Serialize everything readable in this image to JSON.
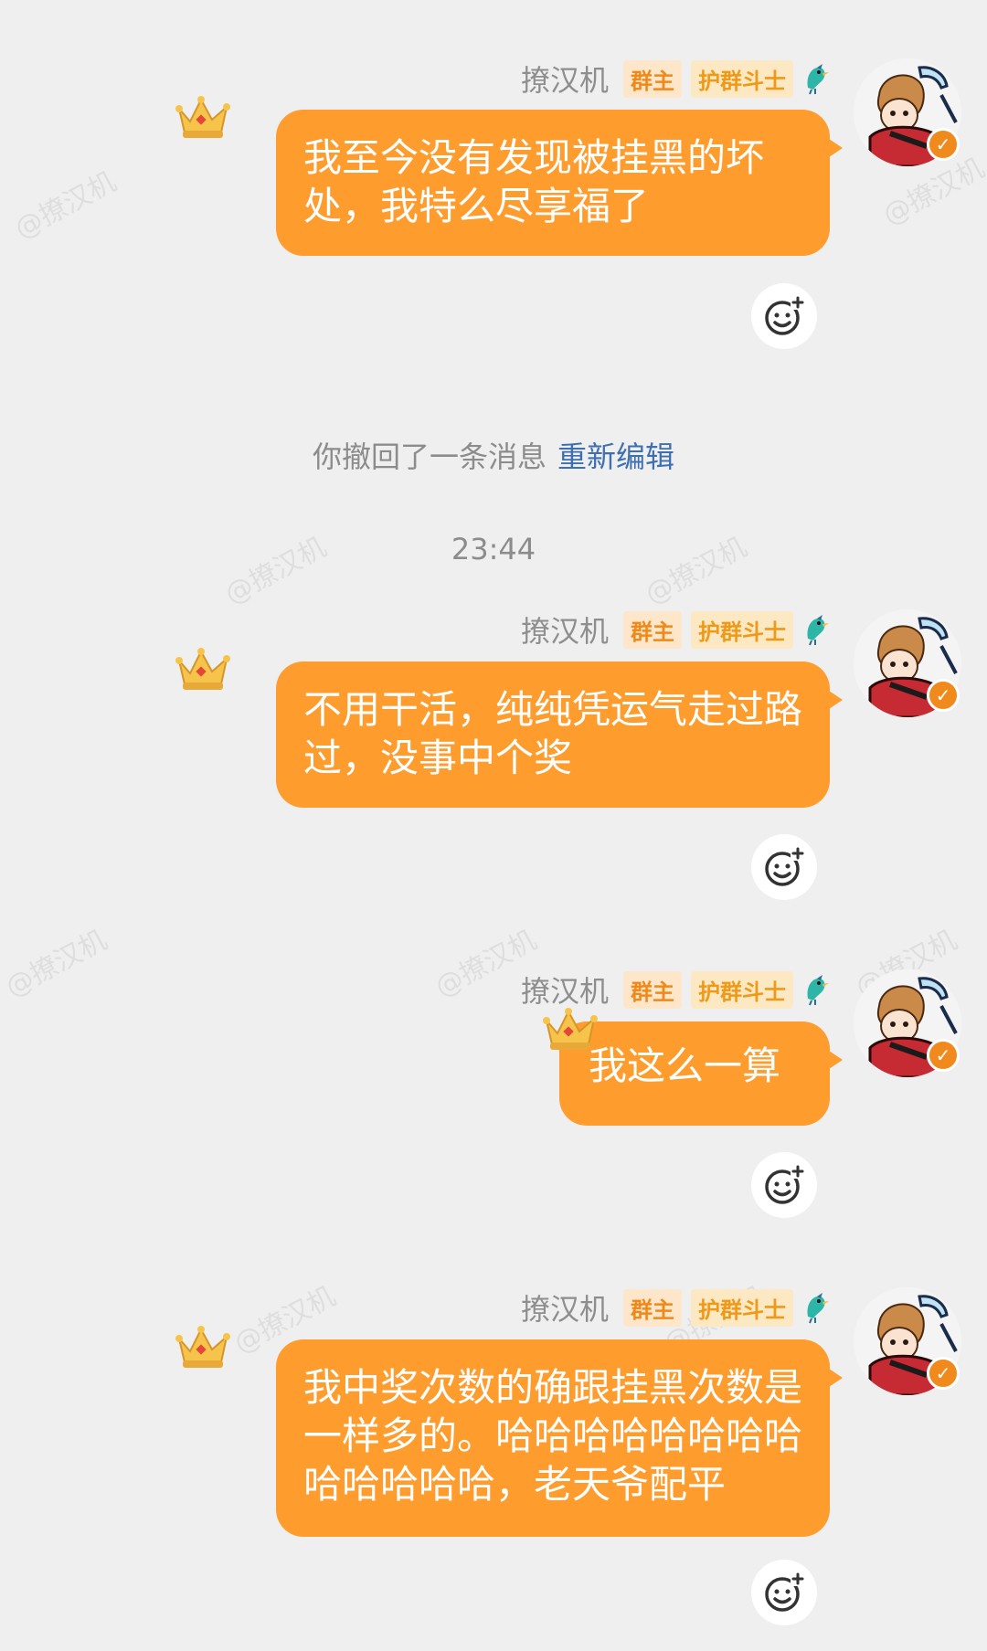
{
  "watermark": "@撩汉机",
  "time_divider": "23:44",
  "system_notice": {
    "text": "你撤回了一条消息",
    "action": "重新编辑"
  },
  "colors": {
    "bubble": "#fe9c2e",
    "badge_text": "#ef8a1a",
    "link": "#3e6fb0"
  },
  "messages": [
    {
      "sender": "撩汉机",
      "badge_owner": "群主",
      "badge_title": "护群斗士",
      "lines": [
        "我至今没有发现被挂黑的坏",
        "处，我特么尽享福了"
      ],
      "react_icon": "add-reaction-icon"
    },
    {
      "sender": "撩汉机",
      "badge_owner": "群主",
      "badge_title": "护群斗士",
      "lines": [
        "不用干活，纯纯凭运气走过路",
        "过，没事中个奖"
      ],
      "react_icon": "add-reaction-icon"
    },
    {
      "sender": "撩汉机",
      "badge_owner": "群主",
      "badge_title": "护群斗士",
      "lines": [
        "我这么一算"
      ],
      "react_icon": "add-reaction-icon"
    },
    {
      "sender": "撩汉机",
      "badge_owner": "群主",
      "badge_title": "护群斗士",
      "lines": [
        "我中奖次数的确跟挂黑次数是",
        "一样多的。哈哈哈哈哈哈哈哈",
        "哈哈哈哈哈，老天爷配平"
      ],
      "react_icon": "add-reaction-icon"
    }
  ]
}
